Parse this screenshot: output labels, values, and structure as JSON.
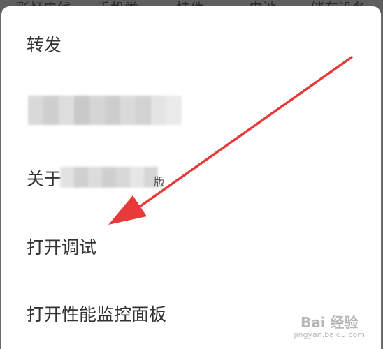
{
  "top_tabs": [
    "彩灯电线",
    "手机类",
    "挂件",
    "电池",
    "储存设备"
  ],
  "menu": {
    "items": [
      {
        "label": "转发"
      },
      {
        "label": ""
      },
      {
        "label": "关于",
        "suffix": "版"
      },
      {
        "label": "打开调试"
      },
      {
        "label": "打开性能监控面板"
      }
    ]
  },
  "watermark": {
    "main": "Bai 经验",
    "sub": "jingyan.baidu.com"
  },
  "colors": {
    "arrow": "#e83a3a",
    "menu_text": "#333333",
    "backdrop": "#6a6a6a"
  }
}
